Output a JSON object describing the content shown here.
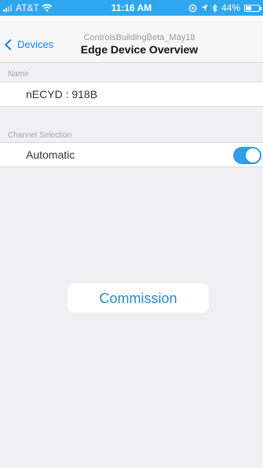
{
  "status_bar": {
    "carrier": "AT&T",
    "time": "11:16 AM",
    "battery": "44%",
    "battery_level": 0.44,
    "icons": [
      "signal-icon",
      "wifi-icon",
      "location-icon",
      "bluetooth-icon",
      "battery-icon"
    ]
  },
  "navbar": {
    "back_label": "Devices",
    "subtitle": "ControlsBuildingBeta_May18",
    "title": "Edge Device Overview"
  },
  "name_section": {
    "label": "Name",
    "value": "nECYD : 918B"
  },
  "channel_section": {
    "label": "Channel Selection",
    "option_label": "Automatic",
    "toggle_on": true
  },
  "commission_button": {
    "label": "Commission"
  },
  "colors": {
    "status_bar": "#2ea6f0",
    "accent": "#1a82f7",
    "toggle_on": "#2f9fe9",
    "background": "#efeff4"
  }
}
